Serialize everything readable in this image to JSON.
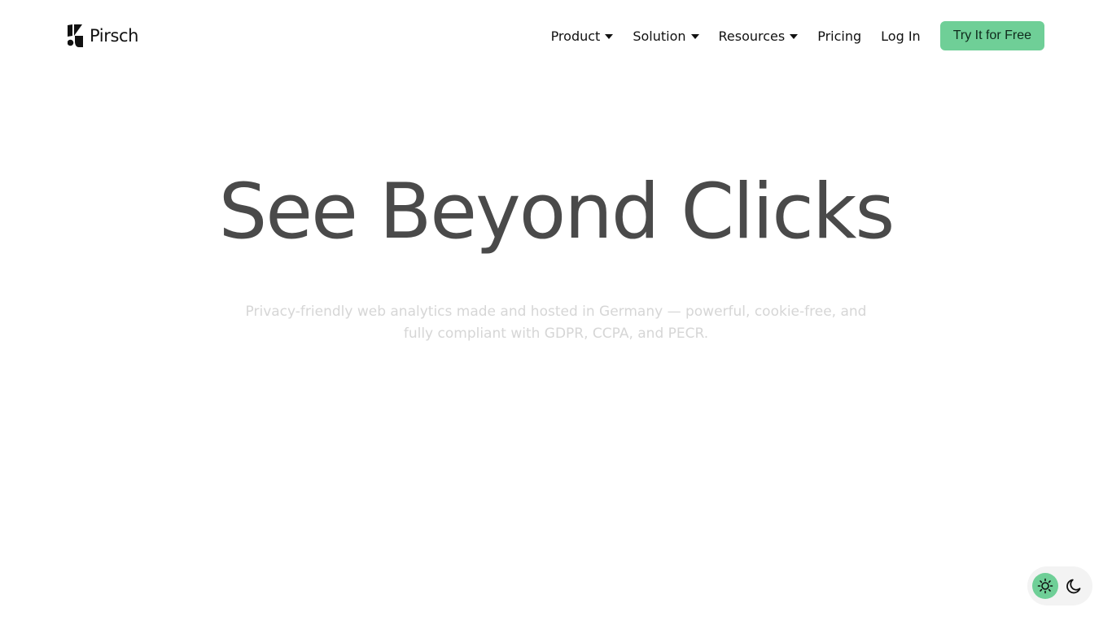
{
  "header": {
    "logo_text": "Pirsch",
    "nav": [
      {
        "label": "Product",
        "has_dropdown": true
      },
      {
        "label": "Solution",
        "has_dropdown": true
      },
      {
        "label": "Resources",
        "has_dropdown": true
      },
      {
        "label": "Pricing",
        "has_dropdown": false
      },
      {
        "label": "Log In",
        "has_dropdown": false
      }
    ],
    "cta_label": "Try It for Free"
  },
  "hero": {
    "title": "See Beyond Clicks",
    "subtitle": "Privacy-friendly web analytics made and hosted in Germany — powerful, cookie-free, and fully compliant with GDPR, CCPA, and PECR."
  },
  "theme_toggle": {
    "options": [
      "light-icon",
      "dark-icon"
    ],
    "active": "light"
  },
  "colors": {
    "accent": "#6fcf97",
    "title": "#4a4a4a",
    "subtitle": "#d6d6d6"
  }
}
